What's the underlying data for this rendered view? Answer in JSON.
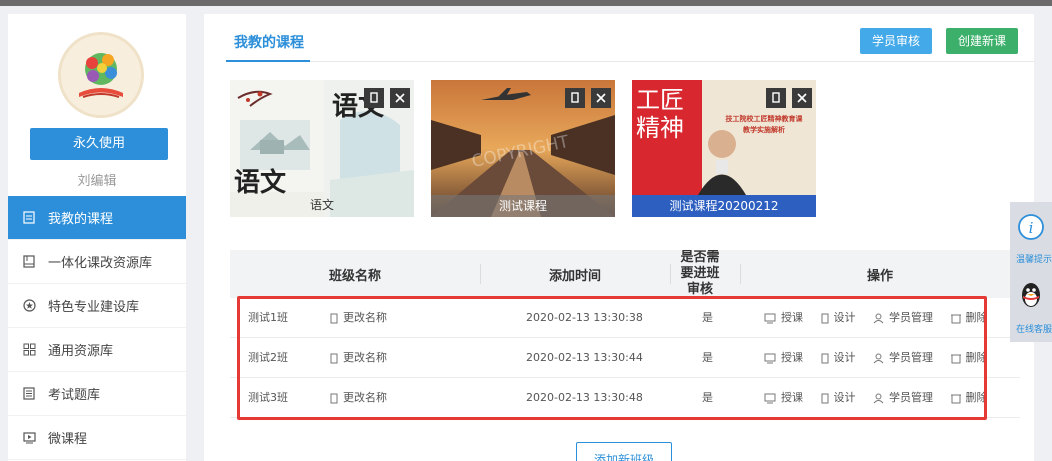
{
  "sidebar": {
    "permanent_button": "永久使用",
    "username": "刘编辑",
    "menu": [
      {
        "label": "我教的课程",
        "icon": "doc-icon",
        "active": true
      },
      {
        "label": "一体化课改资源库",
        "icon": "book-icon",
        "active": false
      },
      {
        "label": "特色专业建设库",
        "icon": "star-icon",
        "active": false
      },
      {
        "label": "通用资源库",
        "icon": "grid-icon",
        "active": false
      },
      {
        "label": "考试题库",
        "icon": "list-icon",
        "active": false
      },
      {
        "label": "微课程",
        "icon": "video-icon",
        "active": false
      }
    ]
  },
  "main": {
    "tab_title": "我教的课程",
    "review_button": "学员审核",
    "create_button": "创建新课",
    "courses": [
      {
        "name": "语文",
        "cover_text_big": "语文",
        "cover_text_small": "语文"
      },
      {
        "name": "测试课程",
        "watermark": "COPYRIGHT"
      },
      {
        "name": "测试课程20200212",
        "cover_big_1": "工匠",
        "cover_big_2": "精神",
        "cover_sub_1": "技工院校工匠精神教育课",
        "cover_sub_2": "教学实施解析"
      }
    ],
    "table": {
      "headers": {
        "name": "班级名称",
        "time": "添加时间",
        "review": "是否需要进班审核",
        "ops": "操作"
      },
      "rename_label": "更改名称",
      "actions": {
        "teach": "授课",
        "design": "设计",
        "students": "学员管理",
        "delete": "删除"
      },
      "rows": [
        {
          "name": "测试1班",
          "time": "2020-02-13 13:30:38",
          "review": "是"
        },
        {
          "name": "测试2班",
          "time": "2020-02-13 13:30:44",
          "review": "是"
        },
        {
          "name": "测试3班",
          "time": "2020-02-13 13:30:48",
          "review": "是"
        }
      ]
    },
    "add_class_button": "添加新班级"
  },
  "float_widget": {
    "tips_label": "温馨提示",
    "service_label": "在线客服"
  },
  "colors": {
    "accent": "#2d8fd9",
    "create_green": "#3cb06a",
    "highlight_red": "#e53935"
  }
}
